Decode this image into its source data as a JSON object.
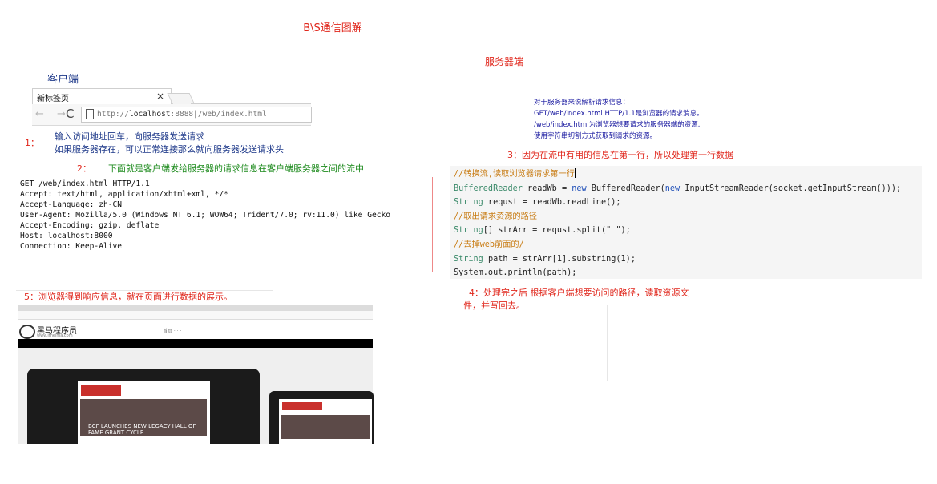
{
  "title": "B\\S通信图解",
  "server_label": "服务器端",
  "client_label": "客户端",
  "browser": {
    "tab_title": "新标签页",
    "tab_close": "×",
    "nav_arrows": "← →",
    "reload": "C",
    "url_prefix": "http://",
    "url_host": "localhost",
    "url_port": ":8888",
    "url_path": "/web/index.html"
  },
  "step1": {
    "number": "1：",
    "line1": "输入访问地址回车，向服务器发送请求",
    "line2": "如果服务器存在，可以正常连接那么就向服务器发送请求头"
  },
  "step2": {
    "number": "2：",
    "text": "下面就是客户端发给服务器的请求信息在客户端服务器之间的流中"
  },
  "request_lines": [
    "GET /web/index.html HTTP/1.1",
    "Accept: text/html, application/xhtml+xml, */*",
    "Accept-Language: zh-CN",
    "User-Agent: Mozilla/5.0 (Windows NT 6.1; WOW64; Trident/7.0; rv:11.0) like Gecko",
    "Accept-Encoding: gzip, deflate",
    "Host: localhost:8000",
    "Connection: Keep-Alive"
  ],
  "step5": "5：浏览器得到响应信息，就在页面进行数据的展示。",
  "thumbnail": {
    "logo": "黑马程序员",
    "logo_sub": "www.itheima.com",
    "nav_links": "首页  ·  ·  ·  ·",
    "banner_text": "BCF LAUNCHES NEW LEGACY HALL OF FAME GRANT CYCLE"
  },
  "server_info": [
    "对于服务器来说解析请求信息：",
    " GET/web/index.html HTTP/1.1是浏览器的请求消息。",
    "/web/index.html为浏览器想要请求的服务器端的资源,",
    "使用字符串切割方式获取到请求的资源。"
  ],
  "step3": "3：因为在流中有用的信息在第一行，所以处理第一行数据",
  "code": {
    "c1": "//转换流,读取浏览器请求第一行",
    "l2_type": "BufferedReader",
    "l2_mid": " readWb = ",
    "l2_new": "new",
    "l2_mid2": " BufferedReader(",
    "l2_new2": "new",
    "l2_end": " InputStreamReader(socket.getInputStream()));",
    "l3_type": "String",
    "l3_rest": " requst = readWb.readLine();",
    "c2": "//取出请求资源的路径",
    "l5_type": "String",
    "l5_rest": "[] strArr = requst.split(\" \");",
    "c3": "//去掉web前面的/",
    "l7_type": "String",
    "l7_rest": " path = strArr[1].substring(1);",
    "l8": "System.out.println(path);"
  },
  "step4": {
    "line1": "4：处理完之后 根据客户端想要访问的路径，读取资源文",
    "line2": "件，并写回去。"
  },
  "colors": {
    "red": "#e0261b",
    "blue": "#1a1aa0",
    "green": "#1c8a1c"
  }
}
